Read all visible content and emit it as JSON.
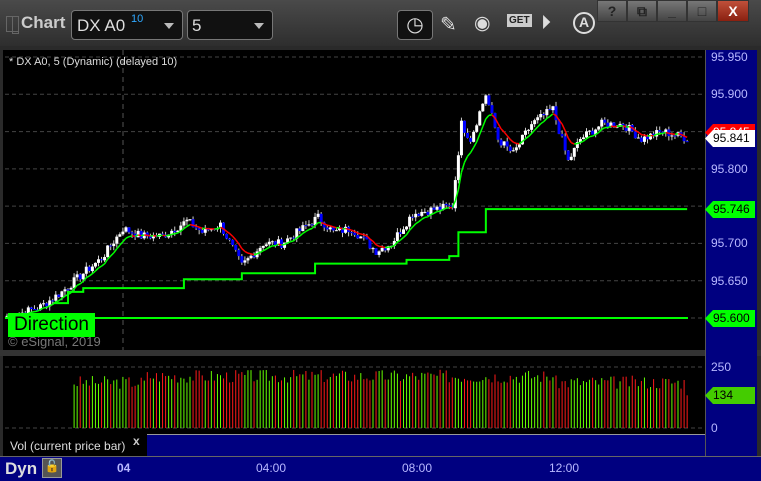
{
  "window": {
    "title": "Chart",
    "help": "?",
    "min": "_",
    "max": "□",
    "close": "X"
  },
  "toolbar": {
    "symbol": "DX A0",
    "symbol_badge": "10",
    "interval": "5",
    "icons": [
      "settings-gear-icon",
      "clock-icon",
      "pencil-icon",
      "study-icon",
      "get-icon",
      "play-icon",
      "annotate-icon"
    ],
    "get_label": "GET",
    "annotate_label": "A"
  },
  "chart": {
    "info": "* DX A0, 5 (Dynamic) (delayed 10)",
    "copyright": "© eSignal, 2019",
    "direction_label": "Direction",
    "price_axis": [
      "95.950",
      "95.900",
      "95.850",
      "95.800",
      "95.750",
      "95.700",
      "95.650",
      "95.600"
    ],
    "tags": {
      "last": "95.841",
      "ma": "95.845",
      "upper_stop": "95.746",
      "lower_stop": "95.600"
    }
  },
  "volume": {
    "label": "Vol (current price bar)",
    "close_label": "x",
    "axis": [
      "250",
      "0"
    ],
    "last_tag": "134"
  },
  "time_axis": {
    "labels": [
      "04",
      "04:00",
      "08:00",
      "12:00"
    ],
    "mode": "Dyn"
  },
  "colors": {
    "up": "#ffffff",
    "down": "#0000ff",
    "ma_up": "#00ff00",
    "ma_down": "#ff0000",
    "stop": "#00ff00",
    "vol_up": "#66ff00",
    "vol_down": "#ff1a1a",
    "axis_bg": "#000080"
  },
  "chart_data": {
    "type": "candlestick",
    "ylim": [
      95.58,
      95.96
    ],
    "bars": 224,
    "close_anchors": [
      [
        0,
        95.603
      ],
      [
        2,
        95.603
      ],
      [
        11,
        95.615
      ],
      [
        18,
        95.635
      ],
      [
        25,
        95.66
      ],
      [
        31,
        95.68
      ],
      [
        38,
        95.72
      ],
      [
        44,
        95.71
      ],
      [
        51,
        95.71
      ],
      [
        59,
        95.73
      ],
      [
        64,
        95.715
      ],
      [
        70,
        95.725
      ],
      [
        77,
        95.67
      ],
      [
        84,
        95.7
      ],
      [
        90,
        95.7
      ],
      [
        97,
        95.72
      ],
      [
        102,
        95.735
      ],
      [
        107,
        95.715
      ],
      [
        113,
        95.72
      ],
      [
        121,
        95.69
      ],
      [
        126,
        95.7
      ],
      [
        133,
        95.74
      ],
      [
        139,
        95.745
      ],
      [
        146,
        95.75
      ],
      [
        149,
        95.86
      ],
      [
        152,
        95.84
      ],
      [
        157,
        95.9
      ],
      [
        161,
        95.84
      ],
      [
        166,
        95.82
      ],
      [
        172,
        95.86
      ],
      [
        179,
        95.88
      ],
      [
        184,
        95.81
      ],
      [
        188,
        95.84
      ],
      [
        195,
        95.86
      ],
      [
        202,
        95.86
      ],
      [
        208,
        95.84
      ],
      [
        215,
        95.85
      ],
      [
        223,
        95.841
      ]
    ],
    "stop_upper": [
      [
        15,
        95.62
      ],
      [
        20,
        95.635
      ],
      [
        25,
        95.64
      ],
      [
        58,
        95.652
      ],
      [
        77,
        95.66
      ],
      [
        101,
        95.673
      ],
      [
        131,
        95.678
      ],
      [
        145,
        95.683
      ],
      [
        148,
        95.715
      ],
      [
        157,
        95.746
      ],
      [
        223,
        95.746
      ]
    ],
    "stop_lower": 95.6,
    "volume_start_bar": 22,
    "volume_range": [
      0,
      250
    ],
    "last_volume": 134
  }
}
